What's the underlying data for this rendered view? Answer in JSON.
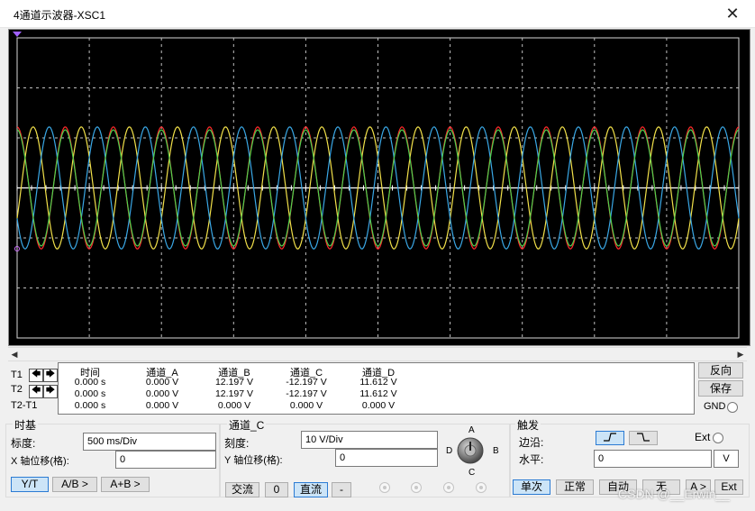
{
  "window": {
    "title": "4通道示波器-XSC1",
    "close_glyph": "✕"
  },
  "screen": {
    "background": "#000000",
    "grid_color": "#bfbfbf",
    "traces": [
      {
        "name": "A",
        "color": "#ff2b2b",
        "amplitude_div": 1.2197,
        "phase_deg": 90
      },
      {
        "name": "B",
        "color": "#f2e14a",
        "amplitude_div": 1.2197,
        "phase_deg": -30
      },
      {
        "name": "C",
        "color": "#3aa8e6",
        "amplitude_div": 1.2197,
        "phase_deg": 210
      },
      {
        "name": "D",
        "color": "#4dd24d",
        "amplitude_div": 1.1612,
        "phase_deg": 90
      }
    ],
    "cycles_shown": 15
  },
  "readout": {
    "headers": [
      "时间",
      "通道_A",
      "通道_B",
      "通道_C",
      "通道_D"
    ],
    "rows": [
      {
        "label": "T1",
        "values": [
          "0.000 s",
          "0.000 V",
          "12.197 V",
          "-12.197 V",
          "11.612 V"
        ]
      },
      {
        "label": "T2",
        "values": [
          "0.000 s",
          "0.000 V",
          "12.197 V",
          "-12.197 V",
          "11.612 V"
        ]
      },
      {
        "label": "T2-T1",
        "values": [
          "0.000 s",
          "0.000 V",
          "0.000 V",
          "0.000 V",
          "0.000 V"
        ]
      }
    ],
    "arrow_left": "🡄",
    "arrow_right": "🡆"
  },
  "right_panel": {
    "reverse": "反向",
    "save": "保存",
    "gnd": "GND"
  },
  "timebase": {
    "title": "时基",
    "scale_label": "标度:",
    "scale_value": "500 ms/Div",
    "xpos_label": "X 轴位移(格):",
    "xpos_value": "0",
    "buttons": [
      "Y/T",
      "A/B >",
      "A+B >"
    ]
  },
  "channel": {
    "title": "通道_C",
    "scale_label": "刻度:",
    "scale_value": "10  V/Div",
    "ypos_label": "Y 轴位移(格):",
    "ypos_value": "0",
    "buttons": [
      "交流",
      "0",
      "直流",
      "-"
    ],
    "knob_labels": {
      "a": "A",
      "b": "B",
      "c": "C",
      "d": "D"
    }
  },
  "trigger": {
    "title": "触发",
    "edge_label": "边沿:",
    "ext_label": "Ext",
    "level_label": "水平:",
    "level_value": "0",
    "level_unit": "V",
    "buttons": [
      "单次",
      "正常",
      "自动",
      "无",
      "A >",
      "Ext"
    ]
  },
  "watermark": "CSDN @__Erwin__"
}
